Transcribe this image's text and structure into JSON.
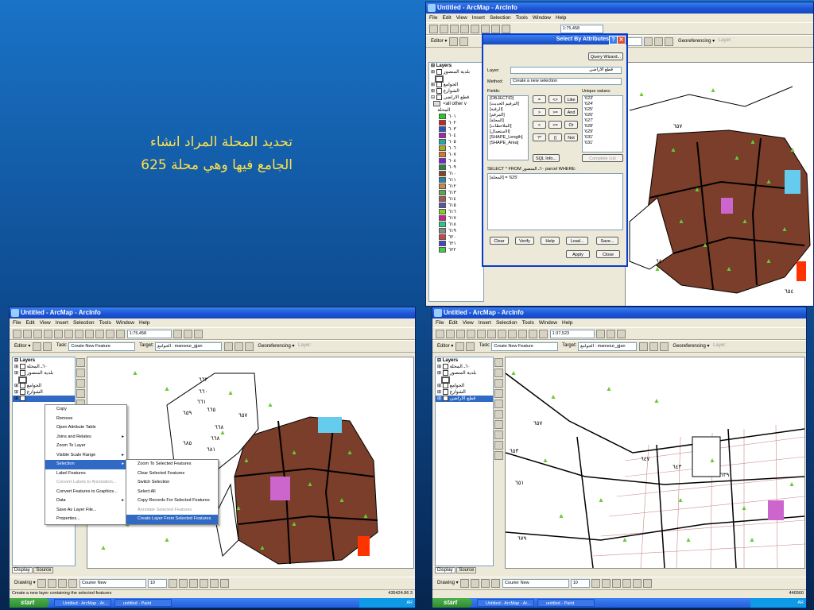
{
  "caption": {
    "line1": "تحديد المحلة المراد انشاء",
    "line2": "الجامع فيها وهي محلة 625"
  },
  "topright": {
    "title": "Untitled - ArcMap - ArcInfo",
    "menu": [
      "File",
      "Edit",
      "View",
      "Insert",
      "Selection",
      "Tools",
      "Window",
      "Help"
    ],
    "scale": "1:75,458",
    "editor_label": "Editor ▾",
    "target_value": "ojan",
    "georef_label": "Georeferencing ▾",
    "layer_label": "Layer:",
    "toc": {
      "root": "Layers",
      "items": [
        "بلدية المنصور",
        "",
        "الجوامع",
        "الشوارع",
        "قطع الاراضي",
        "<all other v",
        "المحلة"
      ],
      "legend": [
        "٦٠١",
        "٦٠٢",
        "٦٠٣",
        "٦٠٤",
        "٦٠٥",
        "٦٠٦",
        "٦٠٧",
        "٦٠٨",
        "٦٠٩",
        "٦١٠",
        "٦١١",
        "٦١٢",
        "٦١٣",
        "٦١٤",
        "٦١٥",
        "٦١٦",
        "٦١٧",
        "٦١٨",
        "٦١٩",
        "٦٢٠",
        "٦٢١",
        "٦٢٢"
      ]
    }
  },
  "dialog": {
    "title": "Select By Attributes",
    "query_wizard": "Query Wizard...",
    "layer_label": "Layer:",
    "layer_value": "قطع الاراضي",
    "method_label": "Method:",
    "method_value": "Create a new selection",
    "fields_label": "Fields:",
    "fields": [
      "[OBJECTID]",
      "[الترقيم الحديث]",
      "[الرقبة]",
      "[المرقم]",
      "[المحلة]",
      "[الملاحظات]",
      "[الاستعمال]",
      "[SHAPE_Length]",
      "[SHAPE_Area]"
    ],
    "ops": [
      "=",
      "<>",
      "Like",
      ">",
      ">=",
      "And",
      "<",
      "<=",
      "Or",
      "?*",
      "()",
      "Not"
    ],
    "unique_label": "Unique values:",
    "unique_values": [
      "'623'",
      "'624'",
      "'625'",
      "'626'",
      "'627'",
      "'628'",
      "'629'",
      "'631'",
      "'631'"
    ],
    "sql_info": "SQL Info...",
    "complete_list": "Complete List",
    "select_text": "SELECT * FROM ٦٠ـ المنصور parcel WHERE:",
    "query": "[المحلة] = '625'",
    "buttons": [
      "Clear",
      "Verify",
      "Help",
      "Load...",
      "Save..."
    ],
    "apply": "Apply",
    "close": "Close"
  },
  "bottomleft": {
    "title": "Untitled - ArcMap - ArcInfo",
    "menu": [
      "File",
      "Edit",
      "View",
      "Insert",
      "Selection",
      "Tools",
      "Window",
      "Help"
    ],
    "scale": "1:75,458",
    "editor_label": "Editor ▾",
    "task_label": "Task:",
    "task_value": "Create New Feature",
    "target_label": "Target:",
    "target_value": "الجوامع : mansour_gjan",
    "georef_label": "Georeferencing ▾",
    "layer_label": "Layer:",
    "toc_items": [
      "Layers",
      "٦٠ـ المحلة",
      "بلدية المنصور",
      "",
      "الجوامع",
      "الشوارع"
    ],
    "context_menu": [
      "Copy",
      "Remove",
      "Open Attribute Table",
      "Joins and Relates",
      "Zoom To Layer",
      "Visible Scale Range",
      "Selection",
      "Label Features",
      "Convert Labels to Annotation...",
      "Convert Features to Graphics...",
      "Data",
      "Save As Layer File...",
      "Properties..."
    ],
    "submenu": [
      "Zoom To Selected Features",
      "Clear Selected Features",
      "Switch Selection",
      "Select All",
      "Copy Records For Selected Features",
      "Annotate Selected Features",
      "Create Layer From Selected Features"
    ],
    "tabs": [
      "Display",
      "Source"
    ],
    "drawing_label": "Drawing ▾",
    "font": "Courier New",
    "font_size": "10",
    "status": "Create a new layer containing the selected features",
    "coords": "435424.86 3",
    "start": "start",
    "tasks": [
      "Untitled - ArcMap - Ar...",
      "untitled - Paint"
    ],
    "tray": "AR"
  },
  "bottomright": {
    "title": "Untitled - ArcMap - ArcInfo",
    "menu": [
      "File",
      "Edit",
      "View",
      "Insert",
      "Selection",
      "Tools",
      "Window",
      "Help"
    ],
    "scale": "1:37,523",
    "editor_label": "Editor ▾",
    "task_label": "Task:",
    "task_value": "Create New Feature",
    "target_label": "Target:",
    "target_value": "الجوامع : mansour_gjan",
    "georef_label": "Georeferencing ▾",
    "layer_label": "Layer:",
    "toc_items": [
      "Layers",
      "٦٠ـ المحلة",
      "بلدية المنصور",
      "",
      "الجوامع",
      "الشوارع",
      "قطع الاراضي"
    ],
    "tabs": [
      "Display",
      "Source"
    ],
    "drawing_label": "Drawing ▾",
    "font": "Courier New",
    "font_size": "10",
    "coords": "440560",
    "start": "start",
    "tasks": [
      "Untitled - ArcMap - Ar...",
      "untitled - Paint"
    ],
    "tray": "AR"
  },
  "map_labels_tr": [
    "٦٥٧",
    "٦٤٠",
    "٦٥٤"
  ],
  "map_labels_bl": [
    "٦٦٣",
    "٦٦٠",
    "٦٦١",
    "٦٥٩",
    "٦٦٥",
    "٦٥٧",
    "٦٦٨",
    "٦٦٨",
    "٦٨١",
    "٦٨٥"
  ],
  "map_labels_br": [
    "٦٥٧",
    "٦٥٣",
    "٦٥١",
    "٦٤٧",
    "٦٤٣",
    "٦٣٩",
    "٦٧٩"
  ],
  "colors": {
    "parcel": "#7a3e2a",
    "road": "#000000",
    "park": "#66cc33",
    "accent": "#316ac5"
  }
}
